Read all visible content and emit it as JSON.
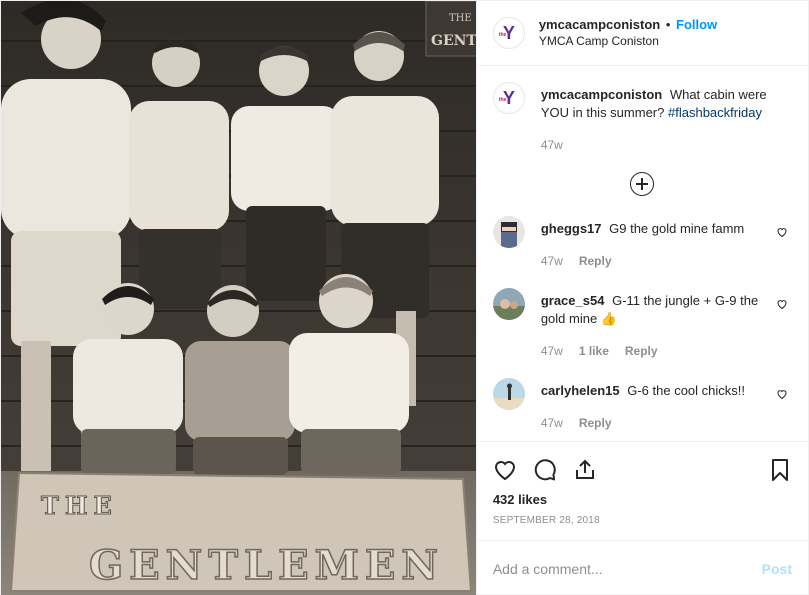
{
  "colors": {
    "accent": "#0095f6",
    "muted": "#8e8e8e",
    "text": "#262626",
    "ymca_purple": "#5c2d91"
  },
  "photo": {
    "sign_small": "THE",
    "sign_large": "GENTLEMEN",
    "door_sign_line1": "THE",
    "door_sign_line2": "GENTI"
  },
  "header": {
    "avatar_letter": "Y",
    "avatar_small": "the",
    "username": "ymcacampconiston",
    "separator": "•",
    "follow_label": "Follow",
    "location": "YMCA Camp Coniston"
  },
  "caption": {
    "username": "ymcacampconiston",
    "text": "What cabin were YOU in this summer?",
    "hashtag": "#flashbackfriday",
    "time": "47w"
  },
  "comments": [
    {
      "username": "gheggs17",
      "text": "G9 the gold mine famm",
      "time": "47w",
      "likes": "",
      "reply": "Reply"
    },
    {
      "username": "grace_s54",
      "text": "G-11 the jungle + G-9 the gold mine 👍",
      "time": "47w",
      "likes": "1 like",
      "reply": "Reply"
    },
    {
      "username": "carlyhelen15",
      "text": "G-6 the cool chicks!!",
      "time": "47w",
      "likes": "",
      "reply": "Reply"
    }
  ],
  "icons": [
    "heart-icon",
    "comment-icon",
    "share-icon",
    "bookmark-icon",
    "plus-circle-icon"
  ],
  "likes": "432 likes",
  "date": "September 28, 2018",
  "add_comment": {
    "placeholder": "Add a comment...",
    "post_label": "Post"
  }
}
